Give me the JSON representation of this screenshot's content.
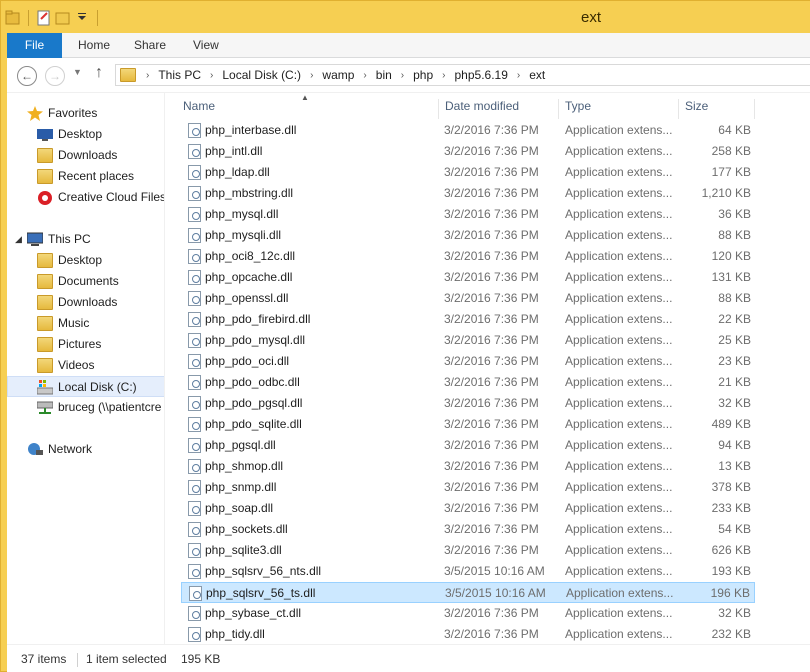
{
  "window": {
    "title": "ext"
  },
  "ribbon": {
    "tabs": [
      {
        "label": "File"
      },
      {
        "label": "Home"
      },
      {
        "label": "Share"
      },
      {
        "label": "View"
      }
    ]
  },
  "address": {
    "breadcrumbs": [
      "This PC",
      "Local Disk (C:)",
      "wamp",
      "bin",
      "php",
      "php5.6.19",
      "ext"
    ]
  },
  "navpane": {
    "favorites": {
      "label": "Favorites",
      "items": [
        {
          "label": "Desktop",
          "icon": "desktop-icon"
        },
        {
          "label": "Downloads",
          "icon": "downloads-folder-icon"
        },
        {
          "label": "Recent places",
          "icon": "recent-places-icon"
        },
        {
          "label": "Creative Cloud Files",
          "icon": "creative-cloud-icon"
        }
      ]
    },
    "thispc": {
      "label": "This PC",
      "items": [
        {
          "label": "Desktop",
          "icon": "desktop-folder-icon"
        },
        {
          "label": "Documents",
          "icon": "documents-folder-icon"
        },
        {
          "label": "Downloads",
          "icon": "downloads-folder-icon"
        },
        {
          "label": "Music",
          "icon": "music-folder-icon"
        },
        {
          "label": "Pictures",
          "icon": "pictures-folder-icon"
        },
        {
          "label": "Videos",
          "icon": "videos-folder-icon"
        },
        {
          "label": "Local Disk (C:)",
          "icon": "local-disk-icon"
        },
        {
          "label": "bruceg (\\\\patientcre",
          "icon": "network-drive-icon"
        }
      ]
    },
    "network": {
      "label": "Network"
    }
  },
  "columns": {
    "name": "Name",
    "date": "Date modified",
    "type": "Type",
    "size": "Size"
  },
  "files": [
    {
      "name": "php_interbase.dll",
      "date": "3/2/2016 7:36 PM",
      "type": "Application extens...",
      "size": "64 KB"
    },
    {
      "name": "php_intl.dll",
      "date": "3/2/2016 7:36 PM",
      "type": "Application extens...",
      "size": "258 KB"
    },
    {
      "name": "php_ldap.dll",
      "date": "3/2/2016 7:36 PM",
      "type": "Application extens...",
      "size": "177 KB"
    },
    {
      "name": "php_mbstring.dll",
      "date": "3/2/2016 7:36 PM",
      "type": "Application extens...",
      "size": "1,210 KB"
    },
    {
      "name": "php_mysql.dll",
      "date": "3/2/2016 7:36 PM",
      "type": "Application extens...",
      "size": "36 KB"
    },
    {
      "name": "php_mysqli.dll",
      "date": "3/2/2016 7:36 PM",
      "type": "Application extens...",
      "size": "88 KB"
    },
    {
      "name": "php_oci8_12c.dll",
      "date": "3/2/2016 7:36 PM",
      "type": "Application extens...",
      "size": "120 KB"
    },
    {
      "name": "php_opcache.dll",
      "date": "3/2/2016 7:36 PM",
      "type": "Application extens...",
      "size": "131 KB"
    },
    {
      "name": "php_openssl.dll",
      "date": "3/2/2016 7:36 PM",
      "type": "Application extens...",
      "size": "88 KB"
    },
    {
      "name": "php_pdo_firebird.dll",
      "date": "3/2/2016 7:36 PM",
      "type": "Application extens...",
      "size": "22 KB"
    },
    {
      "name": "php_pdo_mysql.dll",
      "date": "3/2/2016 7:36 PM",
      "type": "Application extens...",
      "size": "25 KB"
    },
    {
      "name": "php_pdo_oci.dll",
      "date": "3/2/2016 7:36 PM",
      "type": "Application extens...",
      "size": "23 KB"
    },
    {
      "name": "php_pdo_odbc.dll",
      "date": "3/2/2016 7:36 PM",
      "type": "Application extens...",
      "size": "21 KB"
    },
    {
      "name": "php_pdo_pgsql.dll",
      "date": "3/2/2016 7:36 PM",
      "type": "Application extens...",
      "size": "32 KB"
    },
    {
      "name": "php_pdo_sqlite.dll",
      "date": "3/2/2016 7:36 PM",
      "type": "Application extens...",
      "size": "489 KB"
    },
    {
      "name": "php_pgsql.dll",
      "date": "3/2/2016 7:36 PM",
      "type": "Application extens...",
      "size": "94 KB"
    },
    {
      "name": "php_shmop.dll",
      "date": "3/2/2016 7:36 PM",
      "type": "Application extens...",
      "size": "13 KB"
    },
    {
      "name": "php_snmp.dll",
      "date": "3/2/2016 7:36 PM",
      "type": "Application extens...",
      "size": "378 KB"
    },
    {
      "name": "php_soap.dll",
      "date": "3/2/2016 7:36 PM",
      "type": "Application extens...",
      "size": "233 KB"
    },
    {
      "name": "php_sockets.dll",
      "date": "3/2/2016 7:36 PM",
      "type": "Application extens...",
      "size": "54 KB"
    },
    {
      "name": "php_sqlite3.dll",
      "date": "3/2/2016 7:36 PM",
      "type": "Application extens...",
      "size": "626 KB"
    },
    {
      "name": "php_sqlsrv_56_nts.dll",
      "date": "3/5/2015 10:16 AM",
      "type": "Application extens...",
      "size": "193 KB"
    },
    {
      "name": "php_sqlsrv_56_ts.dll",
      "date": "3/5/2015 10:16 AM",
      "type": "Application extens...",
      "size": "196 KB",
      "selected": true
    },
    {
      "name": "php_sybase_ct.dll",
      "date": "3/2/2016 7:36 PM",
      "type": "Application extens...",
      "size": "32 KB"
    },
    {
      "name": "php_tidy.dll",
      "date": "3/2/2016 7:36 PM",
      "type": "Application extens...",
      "size": "232 KB"
    }
  ],
  "status": {
    "item_count": "37 items",
    "selection": "1 item selected",
    "selection_size": "195 KB"
  },
  "colors": {
    "title_bar": "#f6cf52",
    "file_tab": "#1979ca",
    "selected_row": "#cce8ff",
    "selected_row_border": "#99d1ff"
  }
}
